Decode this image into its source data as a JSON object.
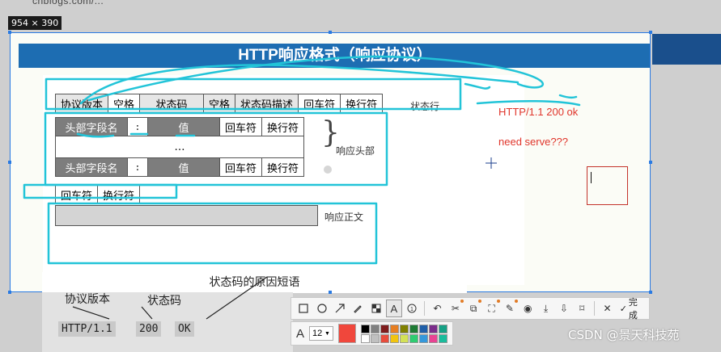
{
  "background": {
    "url_fragment": "cnblogs.com/...",
    "accent_color": "#1a4f8c"
  },
  "selection": {
    "size_badge": "954 × 390",
    "frame_color": "#2a7ae2"
  },
  "slide": {
    "title": "HTTP响应格式（响应协议）",
    "status_row": [
      "协议版本",
      "空格",
      "状态码",
      "空格",
      "状态码描述",
      "回车符",
      "换行符"
    ],
    "status_label": "状态行",
    "header_row_1": [
      "头部字段名",
      ":",
      "值",
      "回车符",
      "换行符"
    ],
    "ellipsis": "…",
    "header_row_2": [
      "头部字段名",
      ":",
      "值",
      "回车符",
      "换行符"
    ],
    "header_label": "响应头部",
    "blank_row": [
      "回车符",
      "换行符"
    ],
    "body_label": "响应正文",
    "caption": "状态码的原因短语"
  },
  "annotations": {
    "line1": "HTTP/1.1 200 ok",
    "line2": "need serve???",
    "text_color": "#e0352b"
  },
  "below": {
    "labels": [
      "协议版本",
      "状态码"
    ],
    "values": [
      "HTTP/1.1",
      "200",
      "OK"
    ]
  },
  "toolbar": {
    "tools": [
      "rectangle-icon",
      "ellipse-icon",
      "arrow-icon",
      "pen-icon",
      "mosaic-icon",
      "text-icon",
      "number-icon",
      "undo-icon",
      "cut-icon",
      "copy-icon",
      "fit-icon",
      "pin-icon",
      "record-icon",
      "download-icon",
      "save-icon"
    ],
    "close_icon": "close-icon",
    "done_label": "完成",
    "font_size": "12",
    "current_color": "#f0473c",
    "palette": [
      "#000000",
      "#808080",
      "#7f1d1d",
      "#e67e22",
      "#808000",
      "#1e7b34",
      "#1f5fa8",
      "#7b2d8b",
      "#16a085",
      "#ffffff",
      "#c0c0c0",
      "#e74c3c",
      "#f1c40f",
      "#d4e157",
      "#2ecc71",
      "#3498db",
      "#e84393",
      "#1abc9c"
    ]
  },
  "watermark": "CSDN @景天科技苑"
}
